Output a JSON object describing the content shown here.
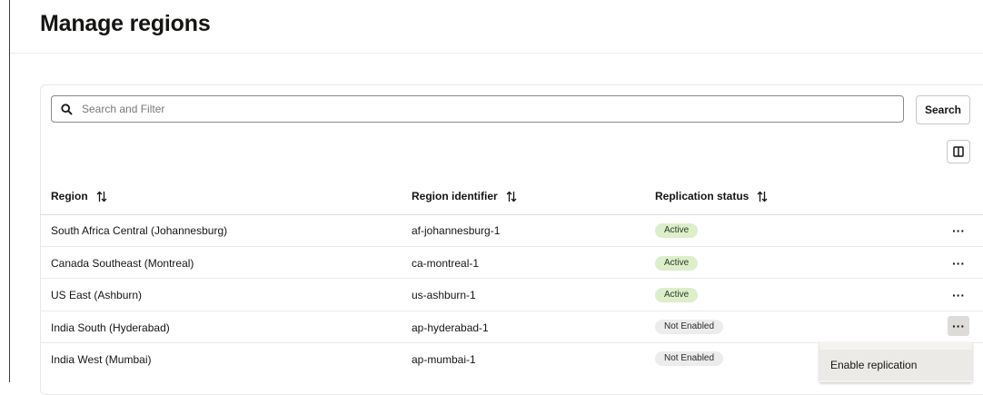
{
  "page": {
    "title": "Manage regions"
  },
  "search": {
    "placeholder": "Search and Filter",
    "value": "",
    "button_label": "Search"
  },
  "table": {
    "columns": [
      "Region",
      "Region identifier",
      "Replication status"
    ],
    "rows": [
      {
        "region": "South Africa Central (Johannesburg)",
        "identifier": "af-johannesburg-1",
        "status": "Active"
      },
      {
        "region": "Canada Southeast (Montreal)",
        "identifier": "ca-montreal-1",
        "status": "Active"
      },
      {
        "region": "US East (Ashburn)",
        "identifier": "us-ashburn-1",
        "status": "Active"
      },
      {
        "region": "India South (Hyderabad)",
        "identifier": "ap-hyderabad-1",
        "status": "Not Enabled"
      },
      {
        "region": "India West (Mumbai)",
        "identifier": "ap-mumbai-1",
        "status": "Not Enabled"
      }
    ],
    "actions_label": "···"
  },
  "context_menu": {
    "items": [
      "Enable replication"
    ]
  },
  "colors": {
    "active_badge": "#dcefc9",
    "not_enabled_badge": "#ececec",
    "text": "#161513"
  },
  "icons": {
    "search": "search-icon",
    "columns": "columns-icon",
    "sort": "sort-icon",
    "more": "more-actions-icon"
  }
}
